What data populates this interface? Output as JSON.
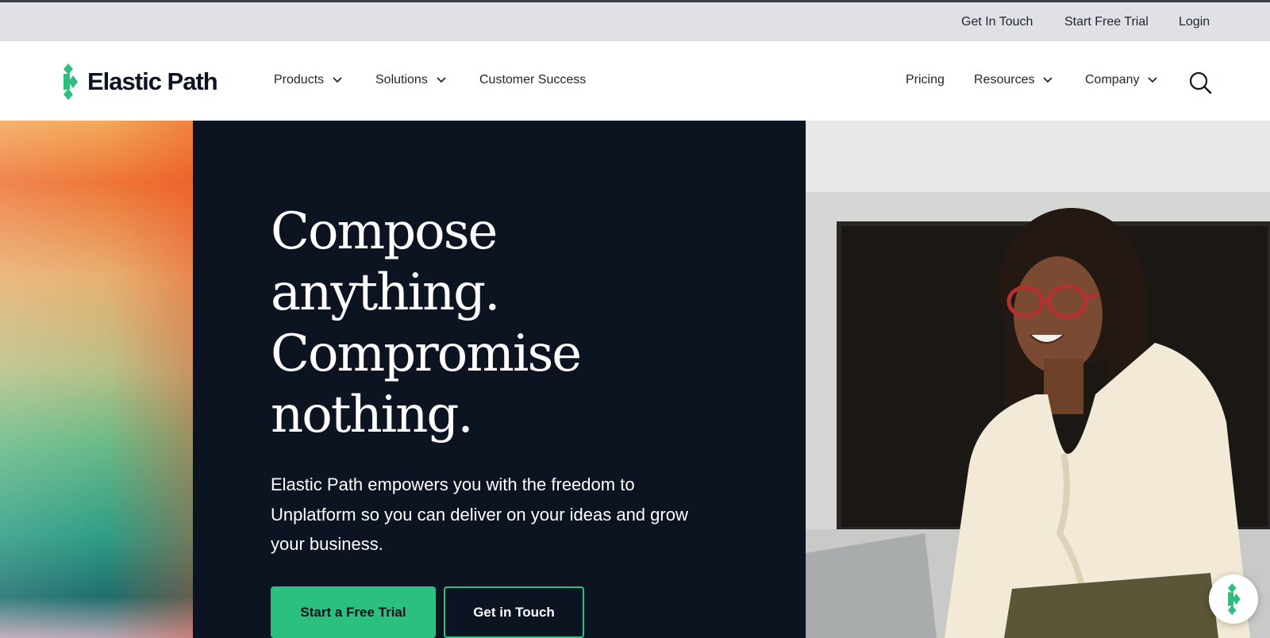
{
  "topbar": {
    "links": [
      "Get In Touch",
      "Start Free Trial",
      "Login"
    ]
  },
  "header": {
    "logo_text": "Elastic Path",
    "nav_left": [
      {
        "label": "Products",
        "dropdown": true
      },
      {
        "label": "Solutions",
        "dropdown": true
      },
      {
        "label": "Customer Success",
        "dropdown": false
      }
    ],
    "nav_right": [
      {
        "label": "Pricing",
        "dropdown": false
      },
      {
        "label": "Resources",
        "dropdown": true
      },
      {
        "label": "Company",
        "dropdown": true
      }
    ],
    "search_icon": "search-icon"
  },
  "hero": {
    "headline_lines": [
      "Compose",
      "anything.",
      "Compromise",
      "nothing."
    ],
    "subtext": "Elastic Path empowers you with the freedom to Unplatform so you can deliver on your ideas and grow your business.",
    "primary_cta": "Start a Free Trial",
    "secondary_cta": "Get in Touch"
  },
  "chat_widget_icon": "elastic-path-logo-icon",
  "colors": {
    "brand_green": "#2bc07d",
    "dark_navy": "#0d1421",
    "topbar_bg": "#dfe1e6"
  }
}
